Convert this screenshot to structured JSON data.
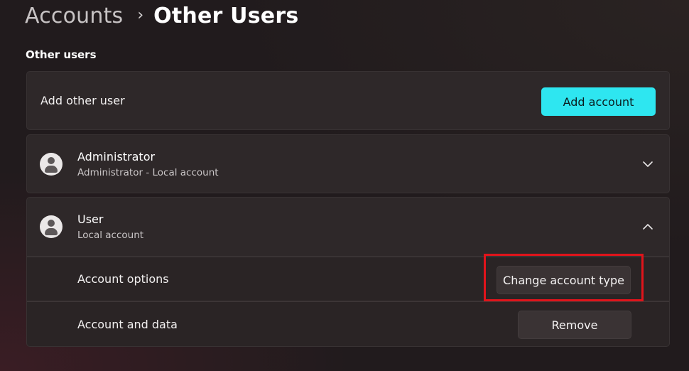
{
  "breadcrumb": {
    "parent": "Accounts",
    "separator": "›",
    "current": "Other Users"
  },
  "section": {
    "title": "Other users"
  },
  "add_user": {
    "label": "Add other user",
    "button_label": "Add account",
    "accent_color": "#2ee6f0"
  },
  "accounts": [
    {
      "name": "Administrator",
      "subtitle": "Administrator - Local account",
      "expanded": false,
      "chevron": "chevron-down-icon"
    },
    {
      "name": "User",
      "subtitle": "Local account",
      "expanded": true,
      "chevron": "chevron-up-icon",
      "options": [
        {
          "label": "Account options",
          "button_label": "Change account type"
        },
        {
          "label": "Account and data",
          "button_label": "Remove"
        }
      ]
    }
  ],
  "annotation": {
    "highlight_color": "#e0141b",
    "highlighted_target": "Change account type"
  }
}
